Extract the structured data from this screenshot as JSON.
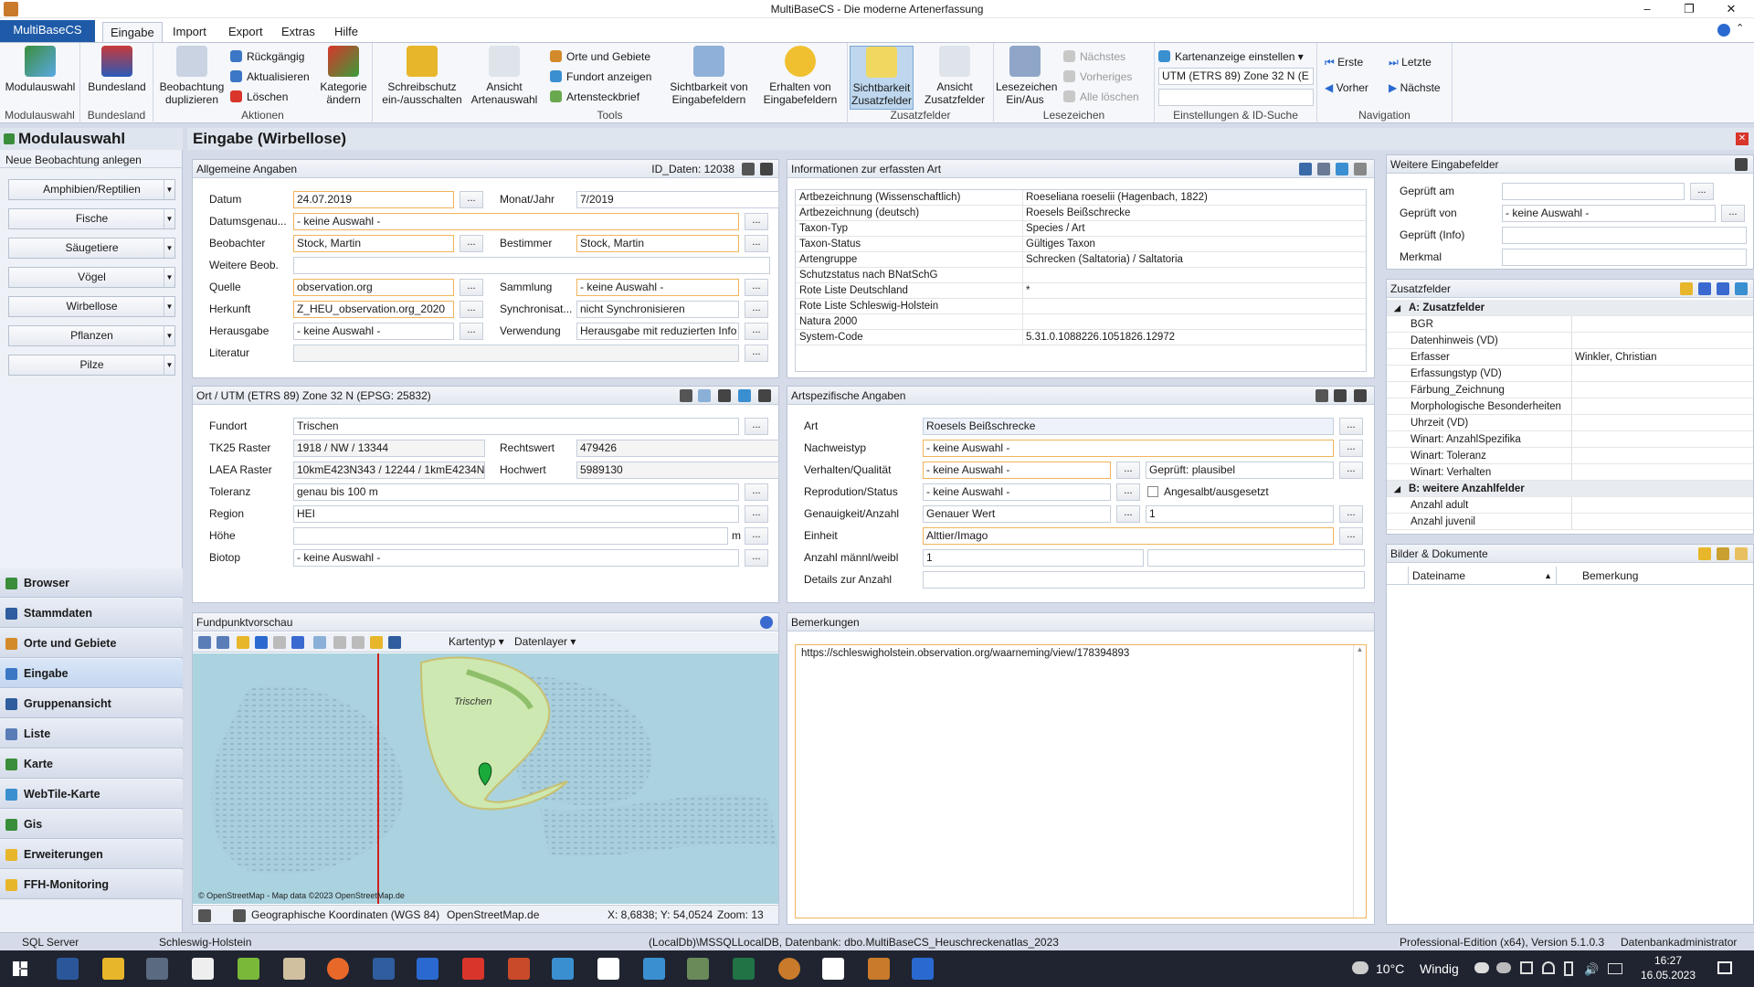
{
  "window": {
    "title": "MultiBaseCS - Die moderne Artenerfassung",
    "min": "–",
    "max": "❐",
    "close": "✕"
  },
  "tabs": [
    "MultiBaseCS",
    "Eingabe",
    "Import",
    "Export",
    "Extras",
    "Hilfe"
  ],
  "ribbon": {
    "modulauswahl": "Modulauswahl",
    "bundesland": "Bundesland",
    "beob_dup": "Beobachtung duplizieren",
    "rueckgaengig": "Rückgängig",
    "aktualisieren": "Aktualisieren",
    "loeschen": "Löschen",
    "kategorie": "Kategorie ändern",
    "g_modul": "Modulauswahl",
    "g_bundesland": "Bundesland",
    "g_aktionen": "Aktionen",
    "schreibschutz": "Schreibschutz ein-/ausschalten",
    "ansicht_art": "Ansicht Artenauswahl",
    "orte": "Orte und Gebiete",
    "fundort": "Fundort anzeigen",
    "steckbrief": "Artensteckbrief",
    "sichtbarkeit_felder": "Sichtbarkeit von Eingabefeldern",
    "erhalten": "Erhalten von Eingabefeldern",
    "g_tools": "Tools",
    "sicht_zusatz": "Sichtbarkeit Zusatzfelder",
    "ansicht_zusatz": "Ansicht Zusatzfelder",
    "g_zusatz": "Zusatzfelder",
    "lesezeichen": "Lesezeichen Ein/Aus",
    "naechstes": "Nächstes",
    "vorheriges": "Vorheriges",
    "alle_loeschen": "Alle löschen",
    "g_lesezeichen": "Lesezeichen",
    "karten": "Kartenanzeige einstellen",
    "utm": "UTM (ETRS 89) Zone 32 N (E",
    "g_einst": "Einstellungen & ID-Suche",
    "erste": "Erste",
    "letzte": "Letzte",
    "vorher": "Vorher",
    "naechste": "Nächste",
    "g_nav": "Navigation"
  },
  "left": {
    "title": "Modulauswahl",
    "new": "Neue Beobachtung anlegen",
    "groups": [
      "Amphibien/Reptilien",
      "Fische",
      "Säugetiere",
      "Vögel",
      "Wirbellose",
      "Pflanzen",
      "Pilze"
    ],
    "nav": [
      "Browser",
      "Stammdaten",
      "Orte und Gebiete",
      "Eingabe",
      "Gruppenansicht",
      "Liste",
      "Karte",
      "WebTile-Karte",
      "Gis",
      "Erweiterungen",
      "FFH-Monitoring"
    ]
  },
  "main": {
    "title": "Eingabe (Wirbellose)"
  },
  "allg": {
    "title": "Allgemeine Angaben",
    "id": "ID_Daten: 12038",
    "l_datum": "Datum",
    "datum": "24.07.2019",
    "l_monat": "Monat/Jahr",
    "monat": "7/2019",
    "l_genau": "Datumsgenau...",
    "genau": "- keine Auswahl -",
    "l_beob": "Beobachter",
    "beob": "Stock, Martin",
    "l_best": "Bestimmer",
    "best": "Stock, Martin",
    "l_weitere": "Weitere Beob.",
    "l_quelle": "Quelle",
    "quelle": "observation.org",
    "l_samml": "Sammlung",
    "samml": "- keine Auswahl -",
    "l_herk": "Herkunft",
    "herk": "Z_HEU_observation.org_2020",
    "l_sync": "Synchronisat...",
    "sync": "nicht Synchronisieren",
    "l_herausg": "Herausgabe",
    "herausg": "- keine Auswahl -",
    "l_verw": "Verwendung",
    "verw": "Herausgabe mit reduzierten Info",
    "l_lit": "Literatur",
    "dots": "..."
  },
  "info": {
    "title": "Informationen zur erfassten Art",
    "rows": [
      [
        "Artbezeichnung (Wissenschaftlich)",
        "Roeseliana roeselii (Hagenbach, 1822)"
      ],
      [
        "Artbezeichnung (deutsch)",
        "Roesels Beißschrecke"
      ],
      [
        "Taxon-Typ",
        "Species / Art"
      ],
      [
        "Taxon-Status",
        "Gültiges Taxon"
      ],
      [
        "Artengruppe",
        "Schrecken (Saltatoria) / Saltatoria"
      ],
      [
        "Schutzstatus nach BNatSchG",
        ""
      ],
      [
        "Rote Liste Deutschland",
        "*"
      ],
      [
        "Rote Liste Schleswig-Holstein",
        ""
      ],
      [
        "Natura 2000",
        ""
      ],
      [
        "System-Code",
        "5.31.0.1088226.1051826.12972"
      ]
    ]
  },
  "ort": {
    "title": "Ort / UTM (ETRS 89) Zone 32 N (EPSG: 25832)",
    "l_fundort": "Fundort",
    "fundort": "Trischen",
    "l_tk": "TK25 Raster",
    "tk": "1918 / NW / 13344",
    "l_rw": "Rechtswert",
    "rw": "479426",
    "l_laea": "LAEA Raster",
    "laea": "10kmE423N343 / 12244 / 1kmE4234N34",
    "l_hw": "Hochwert",
    "hw": "5989130",
    "l_tol": "Toleranz",
    "tol": "genau bis 100 m",
    "l_reg": "Region",
    "reg": "HEI",
    "l_hoehe": "Höhe",
    "m": "m",
    "l_bio": "Biotop",
    "bio": "- keine Auswahl -"
  },
  "art": {
    "title": "Artspezifische Angaben",
    "l_art": "Art",
    "art": "Roesels Beißschrecke",
    "l_nach": "Nachweistyp",
    "nach": "- keine Auswahl -",
    "l_verh": "Verhalten/Qualität",
    "verh": "- keine Auswahl -",
    "gepr": "Geprüft: plausibel",
    "l_repr": "Reprodution/Status",
    "repr": "- keine Auswahl -",
    "angesalbt": "Angesalbt/ausgesetzt",
    "l_gen": "Genauigkeit/Anzahl",
    "gen": "Genauer Wert",
    "anzahl": "1",
    "l_einh": "Einheit",
    "einh": "Alttier/Imago",
    "l_mw": "Anzahl männl/weibl",
    "mw": "1",
    "l_det": "Details zur Anzahl"
  },
  "map": {
    "title": "Fundpunktvorschau",
    "kartentyp": "Kartentyp",
    "datenlayer": "Datenlayer",
    "label": "Trischen",
    "attrib": "© OpenStreetMap - Map data ©2023 OpenStreetMap.de",
    "coords": "Geographische Koordinaten (WGS 84)",
    "src": "OpenStreetMap.de",
    "xy": "X: 8,6838; Y: 54,0524",
    "zoom": "Zoom: 13"
  },
  "bem": {
    "title": "Bemerkungen",
    "text": "https://schleswigholstein.observation.org/waarneming/view/178394893"
  },
  "weitere": {
    "title": "Weitere Eingabefelder",
    "l1": "Geprüft am",
    "l2": "Geprüft von",
    "v2": "- keine Auswahl -",
    "l3": "Geprüft (Info)",
    "l4": "Merkmal"
  },
  "zusatz": {
    "title": "Zusatzfelder",
    "gA": "A: Zusatzfelder",
    "rowsA": [
      [
        "BGR",
        ""
      ],
      [
        "Datenhinweis (VD)",
        ""
      ],
      [
        "Erfasser",
        "Winkler, Christian"
      ],
      [
        "Erfassungstyp (VD)",
        ""
      ],
      [
        "Färbung_Zeichnung",
        ""
      ],
      [
        "Morphologische Besonderheiten",
        ""
      ],
      [
        "Uhrzeit (VD)",
        ""
      ],
      [
        "Winart: AnzahlSpezifika",
        ""
      ],
      [
        "Winart: Toleranz",
        ""
      ],
      [
        "Winart: Verhalten",
        ""
      ]
    ],
    "gB": "B: weitere Anzahlfelder",
    "rowsB": [
      [
        "Anzahl adult",
        ""
      ],
      [
        "Anzahl juvenil",
        ""
      ]
    ]
  },
  "bilder": {
    "title": "Bilder & Dokumente",
    "c1": "Dateiname",
    "c2": "Bemerkung"
  },
  "status": {
    "a": "SQL Server",
    "b": "Schleswig-Holstein",
    "c": "(LocalDb)\\MSSQLLocalDB, Datenbank: dbo.MultiBaseCS_Heuschreckenatlas_2023",
    "d": "Professional-Edition (x64), Version 5.1.0.3",
    "e": "Datenbankadministrator"
  },
  "taskbar": {
    "temp": "10°C",
    "wind": "Windig",
    "time": "16:27",
    "date": "16.05.2023"
  }
}
